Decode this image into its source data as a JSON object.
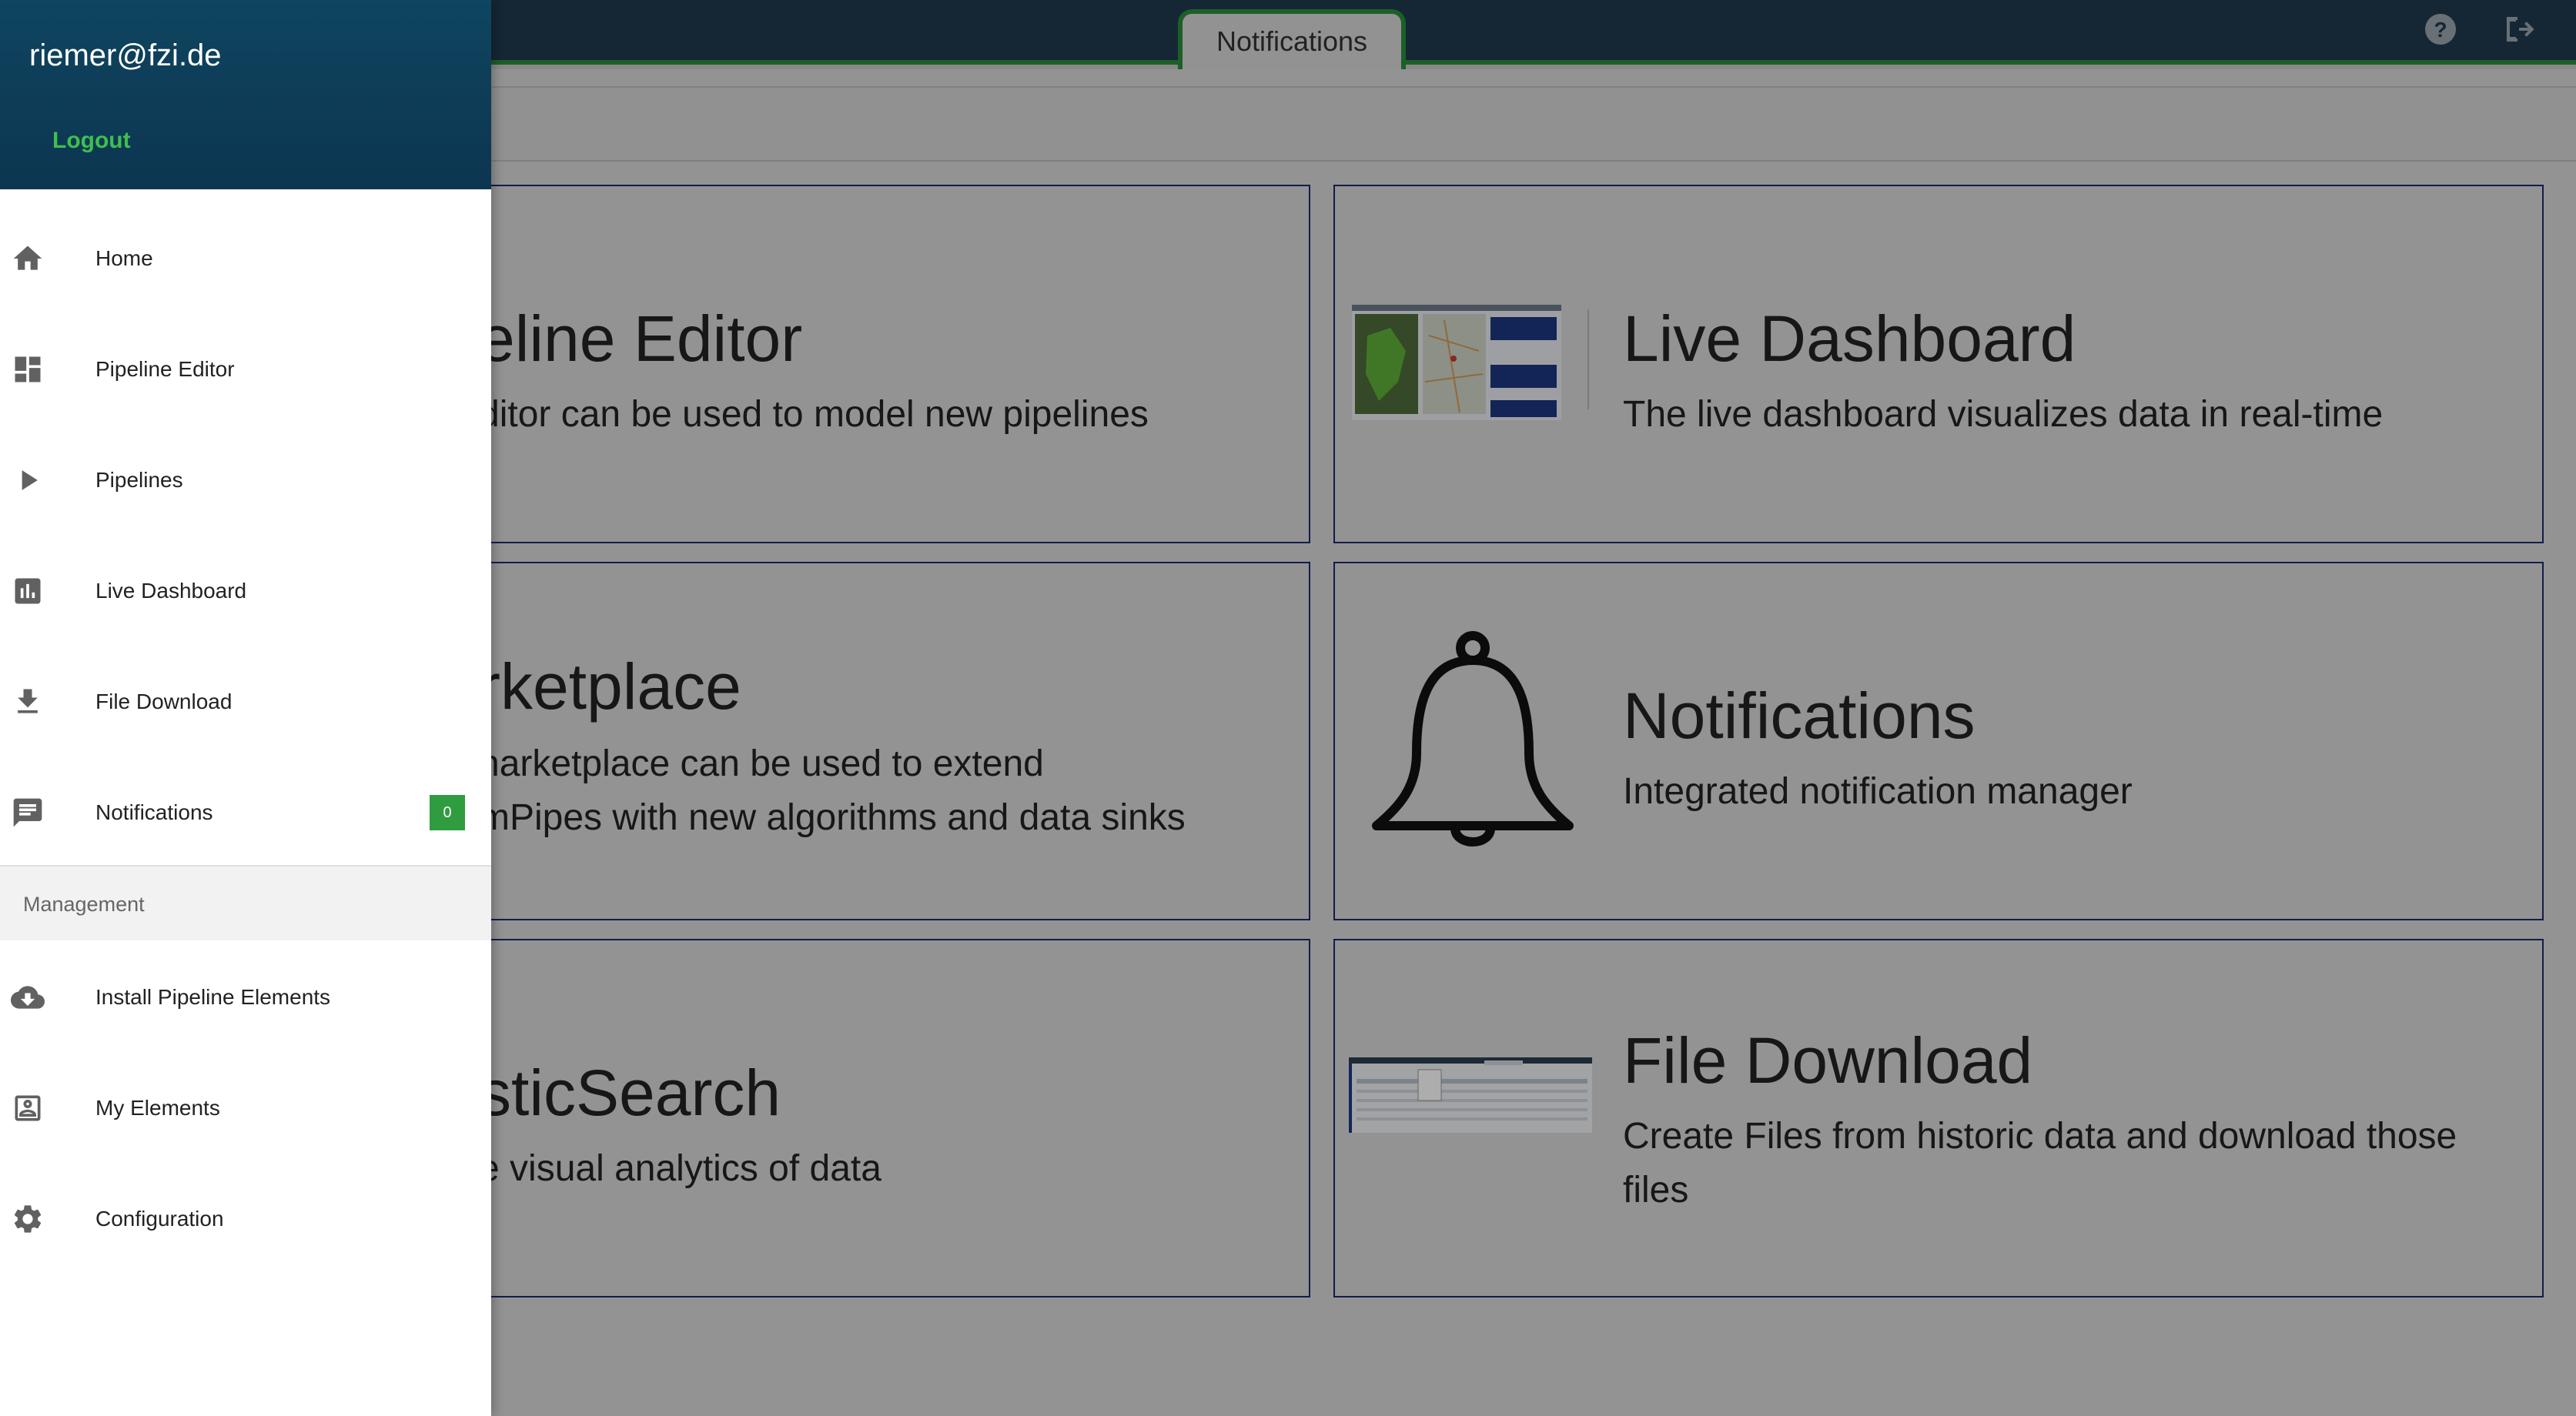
{
  "topbar": {
    "active_tab": "Notifications",
    "help_icon": "help-circle-icon",
    "exit_icon": "exit-to-app-icon"
  },
  "tiles": [
    {
      "title": "eline Editor",
      "description": "ditor can be used to model new pipelines"
    },
    {
      "title": "Live Dashboard",
      "description": "The live dashboard visualizes data in real-time"
    },
    {
      "title": "rketplace",
      "description_line1": "narketplace can be used to extend",
      "description_line2": "mPipes with new algorithms and data sinks"
    },
    {
      "title": "Notifications",
      "description": "Integrated notification manager",
      "icon": "bell-icon"
    },
    {
      "title": "sticSearch",
      "description": "e visual analytics of data"
    },
    {
      "title": "File Download",
      "description_line1": "Create Files from historic data and download those",
      "description_line2": "files"
    }
  ],
  "sidebar": {
    "user_email": "riemer@fzi.de",
    "logout_label": "Logout",
    "items": [
      {
        "label": "Home",
        "icon": "home-icon"
      },
      {
        "label": "Pipeline Editor",
        "icon": "dashboard-icon"
      },
      {
        "label": "Pipelines",
        "icon": "play-icon"
      },
      {
        "label": "Live Dashboard",
        "icon": "bar-chart-icon"
      },
      {
        "label": "File Download",
        "icon": "download-icon"
      },
      {
        "label": "Notifications",
        "icon": "message-icon",
        "badge": "0"
      }
    ],
    "section_label": "Management",
    "management_items": [
      {
        "label": "Install Pipeline Elements",
        "icon": "cloud-download-icon"
      },
      {
        "label": "My Elements",
        "icon": "account-box-icon"
      },
      {
        "label": "Configuration",
        "icon": "gear-icon"
      }
    ]
  },
  "colors": {
    "topbar": "#1f3a4d",
    "accent_green": "#2c8c3c",
    "tile_border": "#1d2a6e",
    "sidebar_header": "#0e4560",
    "logout": "#3fbf4f",
    "badge": "#2f9d3f"
  }
}
